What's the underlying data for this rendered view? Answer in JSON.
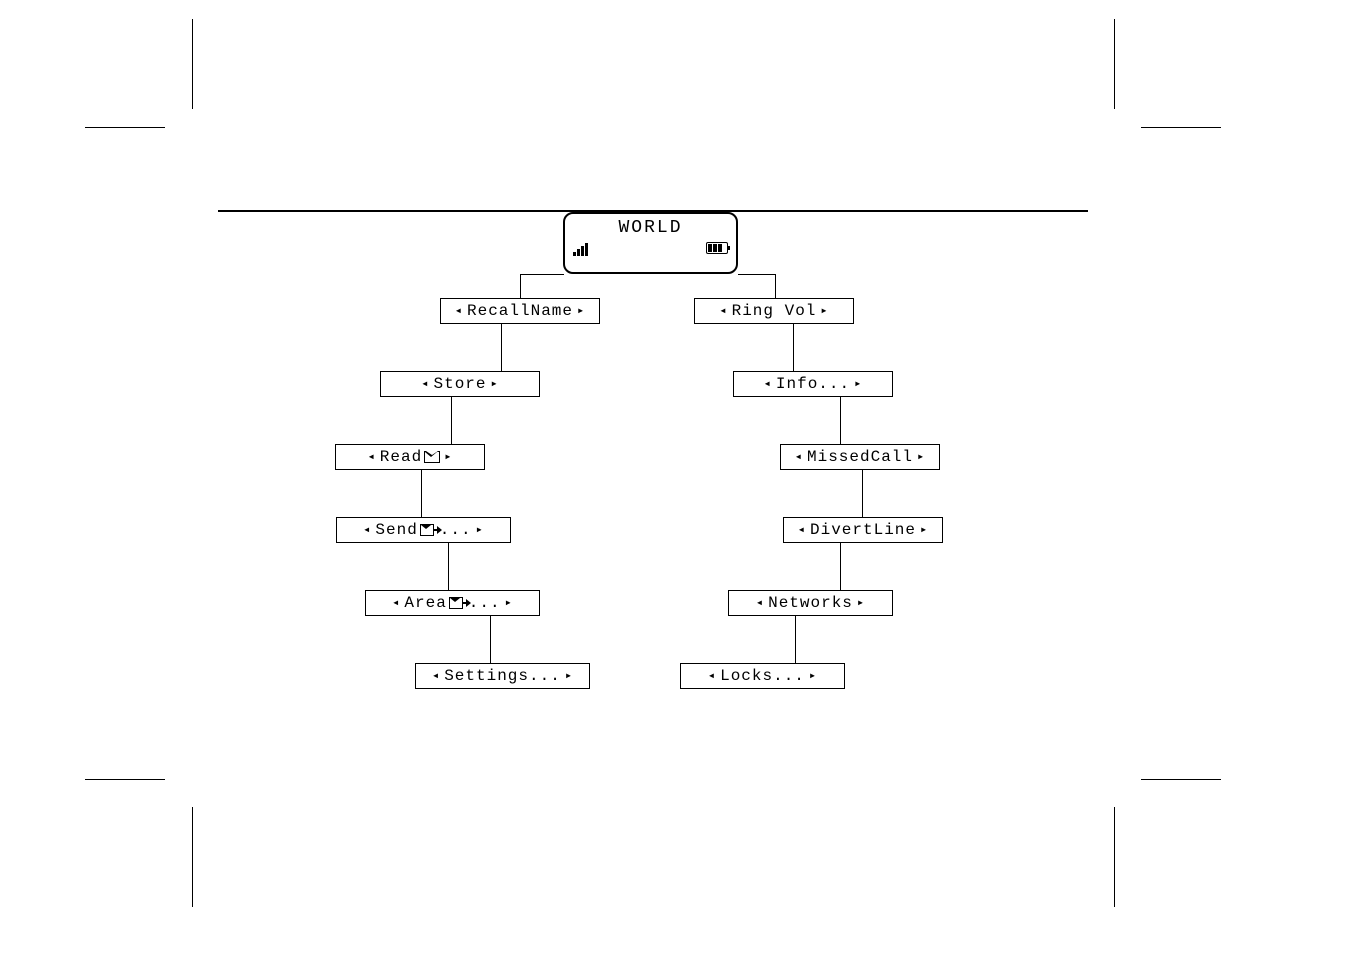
{
  "lcd": {
    "title": "WORLD"
  },
  "menu": {
    "left": [
      {
        "label": "RecallName",
        "icon": null
      },
      {
        "label": "Store",
        "icon": null
      },
      {
        "label": "Read",
        "icon": "envelope"
      },
      {
        "label": "Send",
        "icon": "reply",
        "trailing": "..."
      },
      {
        "label": "Area",
        "icon": "reply",
        "trailing": "..."
      },
      {
        "label": "Settings...",
        "icon": null
      }
    ],
    "right": [
      {
        "label": "Ring Vol",
        "icon": null
      },
      {
        "label": "Info...",
        "icon": null
      },
      {
        "label": "MissedCall",
        "icon": null
      },
      {
        "label": "DivertLine",
        "icon": null
      },
      {
        "label": "Networks",
        "icon": null
      },
      {
        "label": "Locks...",
        "icon": null
      }
    ]
  }
}
